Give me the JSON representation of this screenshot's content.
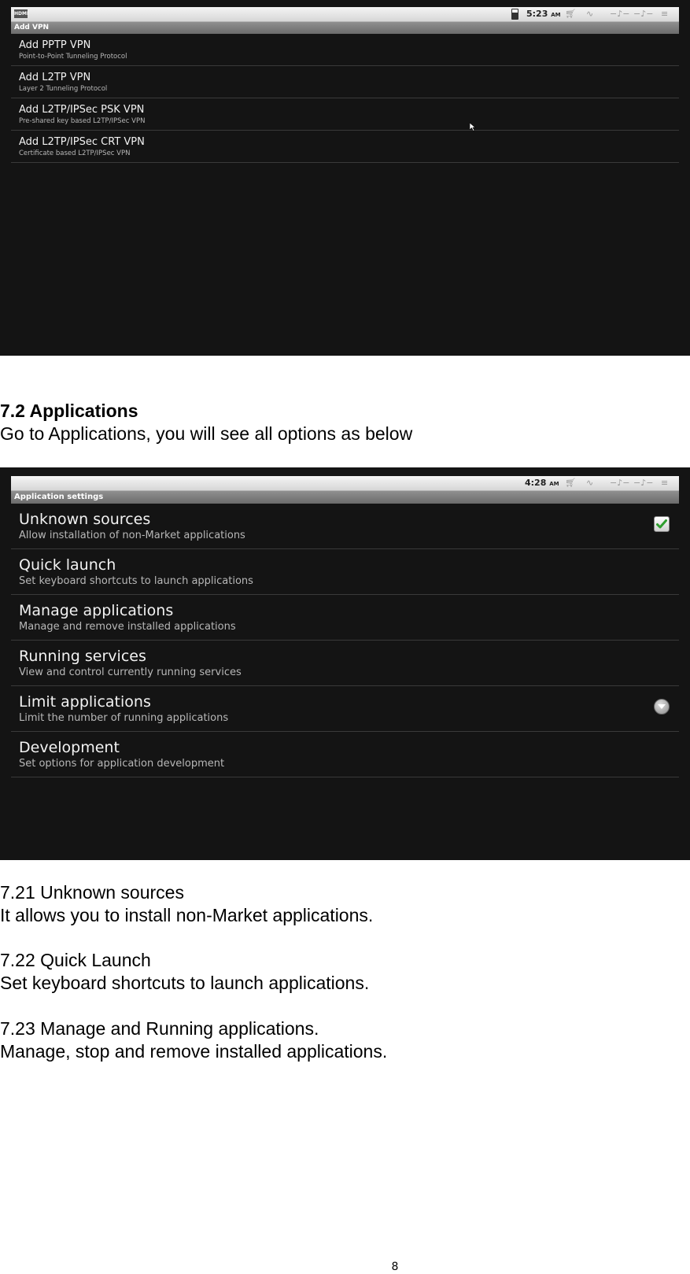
{
  "screenshot1": {
    "status_time": "5:23",
    "status_ampm": "AM",
    "hdmi_label": "HDMI",
    "title": "Add VPN",
    "items": [
      {
        "title": "Add PPTP VPN",
        "subtitle": "Point-to-Point Tunneling Protocol"
      },
      {
        "title": "Add L2TP VPN",
        "subtitle": "Layer 2 Tunneling Protocol"
      },
      {
        "title": "Add L2TP/IPSec PSK VPN",
        "subtitle": "Pre-shared key based L2TP/IPSec VPN"
      },
      {
        "title": "Add L2TP/IPSec CRT VPN",
        "subtitle": "Certificate based L2TP/IPSec VPN"
      }
    ]
  },
  "section_7_2": {
    "heading": "7.2 Applications",
    "intro": "Go to Applications, you will see all options as below"
  },
  "screenshot2": {
    "status_time": "4:28",
    "status_ampm": "AM",
    "title": "Application settings",
    "items": [
      {
        "title": "Unknown sources",
        "subtitle": "Allow installation of non-Market applications",
        "checked": true
      },
      {
        "title": "Quick launch",
        "subtitle": "Set keyboard shortcuts to launch applications"
      },
      {
        "title": "Manage applications",
        "subtitle": "Manage and remove installed applications"
      },
      {
        "title": "Running services",
        "subtitle": "View and control currently running services"
      },
      {
        "title": "Limit applications",
        "subtitle": "Limit the number of running applications"
      },
      {
        "title": "Development",
        "subtitle": "Set options for application development"
      }
    ]
  },
  "section_7_21": {
    "heading": "7.21 Unknown sources",
    "body": "It allows you to install non-Market applications."
  },
  "section_7_22": {
    "heading": "7.22 Quick Launch",
    "body": "Set keyboard shortcuts to launch applications."
  },
  "section_7_23": {
    "heading": "7.23 Manage and Running applications.",
    "body": "Manage, stop and remove installed applications."
  },
  "page_number": "8",
  "colors": {
    "screen_bg": "#141414",
    "checkbox_green": "#2e9e2e"
  }
}
